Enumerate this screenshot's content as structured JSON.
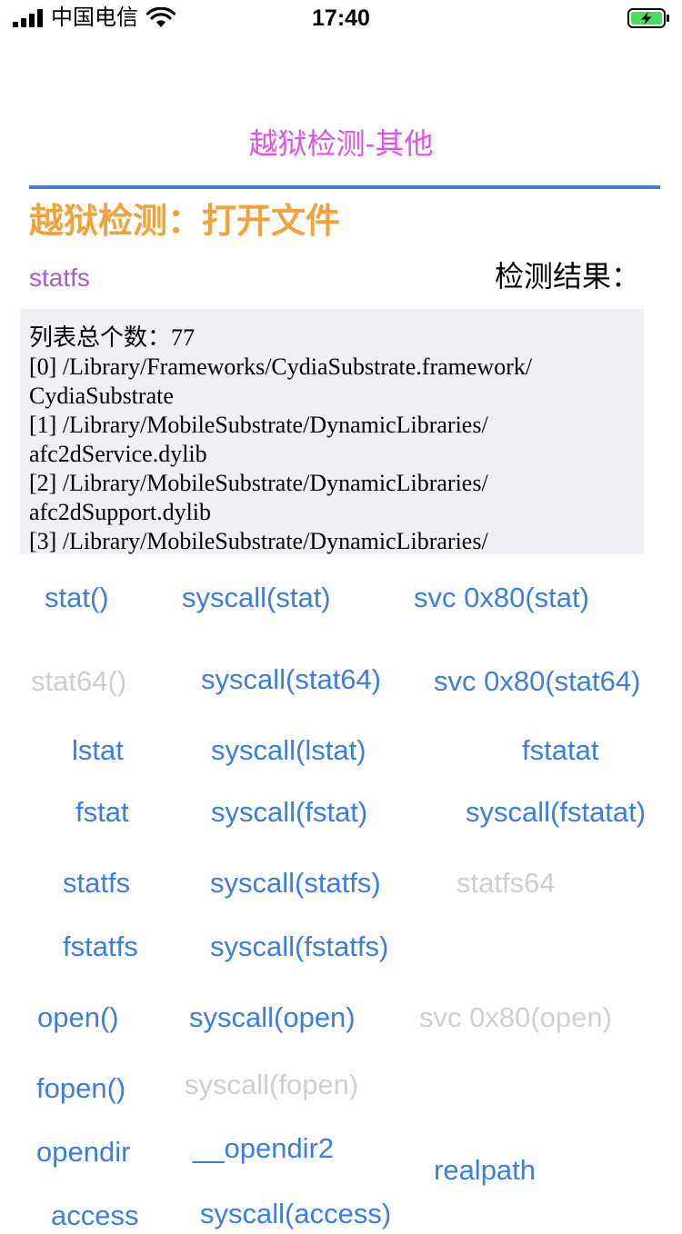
{
  "status_bar": {
    "carrier": "中国电信",
    "time": "17:40",
    "battery_color": "#4cd964"
  },
  "nav": {
    "title": "越狱检测-其他"
  },
  "section": {
    "title": "越狱检测：打开文件",
    "method_label": "statfs",
    "result_label": "检测结果："
  },
  "result": {
    "lines": [
      "列表总个数：77",
      "[0] /Library/Frameworks/CydiaSubstrate.framework/",
      "CydiaSubstrate",
      "[1] /Library/MobileSubstrate/DynamicLibraries/",
      "afc2dService.dylib",
      "[2] /Library/MobileSubstrate/DynamicLibraries/",
      "afc2dSupport.dylib",
      "[3] /Library/MobileSubstrate/DynamicLibraries/"
    ]
  },
  "buttons": {
    "stat": "stat()",
    "syscall_stat": "syscall(stat)",
    "svc_stat": "svc 0x80(stat)",
    "stat64": "stat64()",
    "syscall_stat64": "syscall(stat64)",
    "svc_stat64": "svc 0x80(stat64)",
    "lstat": "lstat",
    "syscall_lstat": "syscall(lstat)",
    "fstatat": "fstatat",
    "fstat": "fstat",
    "syscall_fstat": "syscall(fstat)",
    "syscall_fstatat": "syscall(fstatat)",
    "statfs": "statfs",
    "syscall_statfs": "syscall(statfs)",
    "statfs64": "statfs64",
    "fstatfs": "fstatfs",
    "syscall_fstatfs": "syscall(fstatfs)",
    "open": "open()",
    "syscall_open": "syscall(open)",
    "svc_open": "svc 0x80(open)",
    "fopen": "fopen()",
    "syscall_fopen": "syscall(fopen)",
    "opendir": "opendir",
    "opendir2": "__opendir2",
    "realpath": "realpath",
    "access": "access",
    "syscall_access": "syscall(access)"
  },
  "colors": {
    "accent": "#3b7de3",
    "title": "#e052e6",
    "section": "#f0a33c",
    "method": "#a55bd1",
    "disabled": "#cfcfcf",
    "result_bg": "#efeff4"
  }
}
